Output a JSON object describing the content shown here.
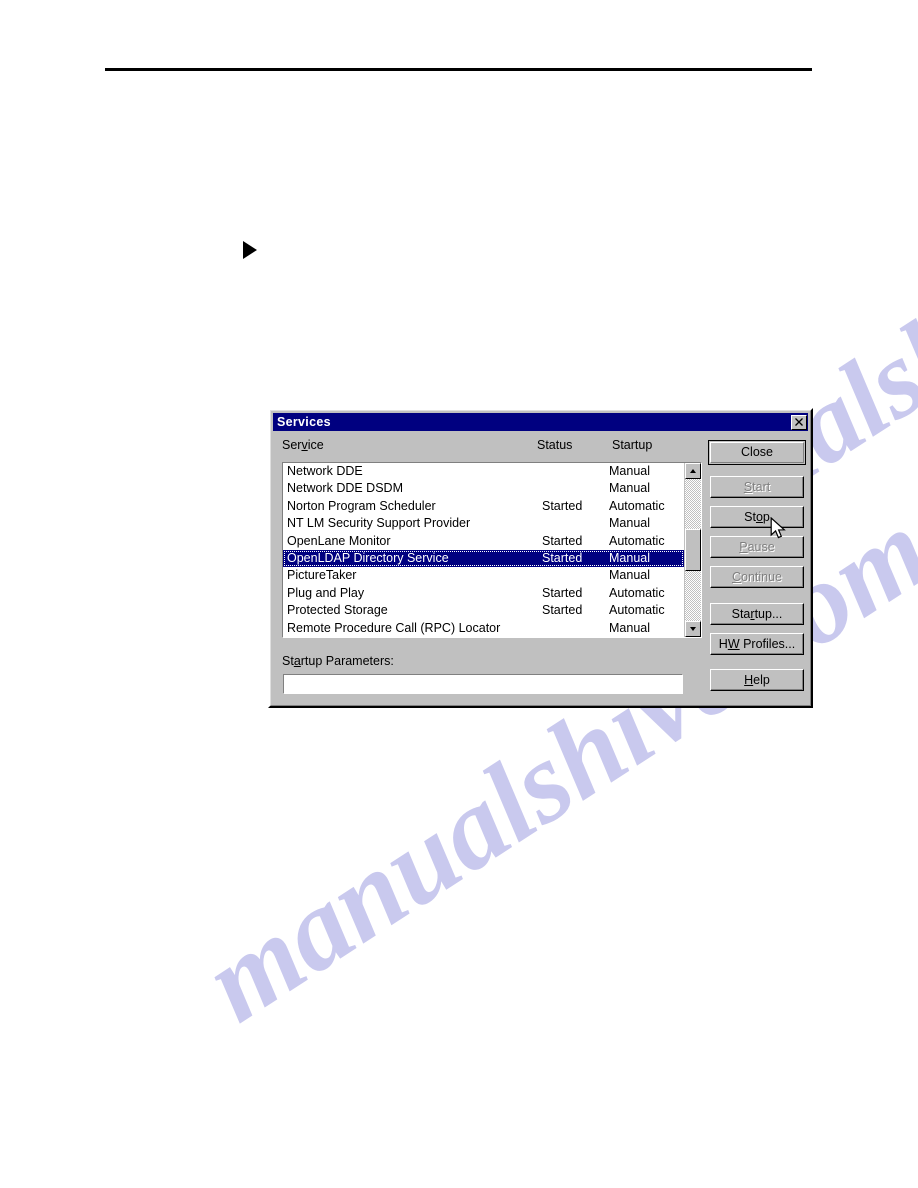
{
  "page": {
    "rule_present": true,
    "bullet_glyph": "▶"
  },
  "watermark": {
    "text_1": "manualshive.com",
    "text_2": "manualshive.com"
  },
  "dialog": {
    "title": "Services",
    "close_icon_label": "×",
    "columns": {
      "service": "Service",
      "service_accel": "v",
      "status": "Status",
      "startup": "Startup"
    },
    "rows": [
      {
        "name": "Network DDE",
        "status": "",
        "startup": "Manual",
        "selected": false
      },
      {
        "name": "Network DDE DSDM",
        "status": "",
        "startup": "Manual",
        "selected": false
      },
      {
        "name": "Norton Program Scheduler",
        "status": "Started",
        "startup": "Automatic",
        "selected": false
      },
      {
        "name": "NT LM Security Support Provider",
        "status": "",
        "startup": "Manual",
        "selected": false
      },
      {
        "name": "OpenLane Monitor",
        "status": "Started",
        "startup": "Automatic",
        "selected": false
      },
      {
        "name": "OpenLDAP Directory Service",
        "status": "Started",
        "startup": "Manual",
        "selected": true
      },
      {
        "name": "PictureTaker",
        "status": "",
        "startup": "Manual",
        "selected": false
      },
      {
        "name": "Plug and Play",
        "status": "Started",
        "startup": "Automatic",
        "selected": false
      },
      {
        "name": "Protected Storage",
        "status": "Started",
        "startup": "Automatic",
        "selected": false
      },
      {
        "name": "Remote Procedure Call (RPC) Locator",
        "status": "",
        "startup": "Manual",
        "selected": false
      }
    ],
    "scrollbar": {
      "up_arrow": "▲",
      "down_arrow": "▼",
      "thumb_position_percent": 50
    },
    "startup_parameters": {
      "label_before": "St",
      "label_accel": "a",
      "label_after": "rtup Parameters:",
      "value": "",
      "placeholder": ""
    },
    "buttons": [
      {
        "id": "close",
        "before": "",
        "accel": "",
        "after": "Close",
        "disabled": false,
        "default": true
      },
      {
        "id": "start",
        "before": "",
        "accel": "S",
        "after": "tart",
        "disabled": true,
        "default": false
      },
      {
        "id": "stop",
        "before": "St",
        "accel": "o",
        "after": "p",
        "disabled": false,
        "default": false
      },
      {
        "id": "pause",
        "before": "",
        "accel": "P",
        "after": "ause",
        "disabled": true,
        "default": false
      },
      {
        "id": "continue",
        "before": "",
        "accel": "C",
        "after": "ontinue",
        "disabled": true,
        "default": false
      },
      {
        "id": "startup",
        "before": "Sta",
        "accel": "r",
        "after": "tup...",
        "disabled": false,
        "default": false
      },
      {
        "id": "hw-profiles",
        "before": "H",
        "accel": "W",
        "after": " Profiles...",
        "disabled": false,
        "default": false
      },
      {
        "id": "help",
        "before": "",
        "accel": "H",
        "after": "elp",
        "disabled": false,
        "default": false
      }
    ]
  },
  "colors": {
    "titlebar": "#000080",
    "selection": "#000080",
    "dialog_face": "#c0c0c0",
    "disabled_text": "#808080",
    "watermark": "#c9c9ee"
  }
}
